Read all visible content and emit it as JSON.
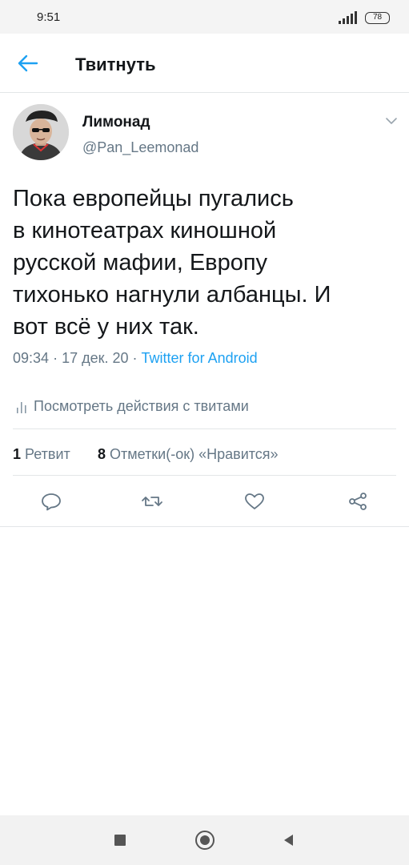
{
  "status_bar": {
    "time": "9:51",
    "battery": "78",
    "icons": [
      "signal-icon",
      "battery-icon"
    ]
  },
  "header": {
    "title": "Твитнуть",
    "back_icon": "arrow-left-icon"
  },
  "tweet": {
    "author_name": "Лимонад",
    "author_handle": "@Pan_Leemonad",
    "text_lines": [
      "Пока европейцы пугались",
      "в кинотеатрах киношной",
      "русской мафии, Европу",
      "тихонько нагнули албанцы. И",
      "вот всё у них так."
    ],
    "time": "09:34",
    "date": "17 дек. 20",
    "source": "Twitter for Android",
    "separator": "·"
  },
  "activity": {
    "label": "Посмотреть действия с твитами"
  },
  "stats": {
    "retweets_count": "1",
    "retweets_label": "Ретвит",
    "likes_count": "8",
    "likes_label": "Отметки(-ок) «Нравится»"
  },
  "actions": [
    "reply-icon",
    "retweet-icon",
    "like-icon",
    "share-icon"
  ],
  "colors": {
    "accent": "#1da1f2",
    "text_primary": "#14171a",
    "text_secondary": "#657786",
    "divider": "#e3e6e8"
  }
}
